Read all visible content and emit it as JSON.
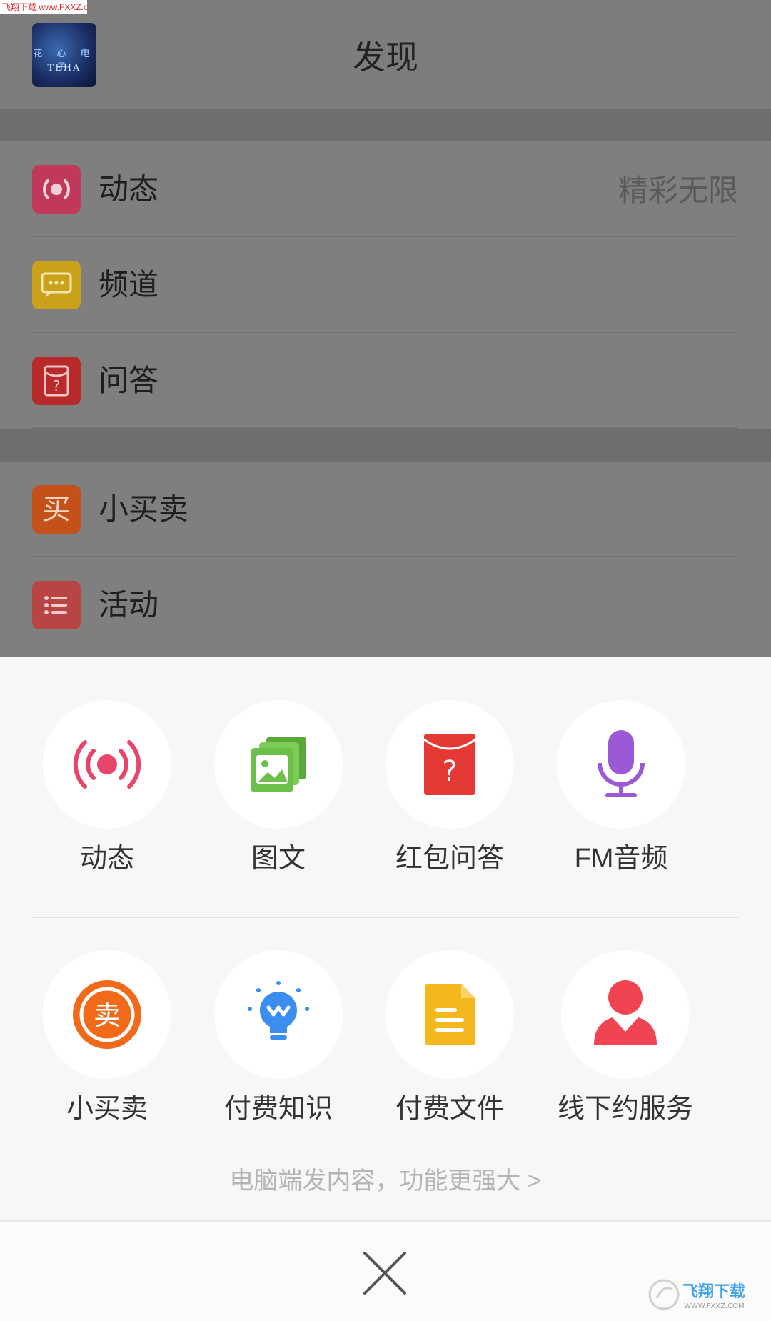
{
  "watermark_top": "飞翔下载 www.FXXZ.com",
  "header": {
    "title": "发现",
    "logo_text_cn": "花 心 电 子",
    "logo_text_en": "TEHA"
  },
  "list_group1": [
    {
      "label": "动态",
      "aside": "精彩无限",
      "icon": "broadcast-icon",
      "color": "#c0395b"
    },
    {
      "label": "频道",
      "aside": "",
      "icon": "chat-bubble-icon",
      "color": "#c9a21a"
    },
    {
      "label": "问答",
      "aside": "",
      "icon": "question-envelope-icon",
      "color": "#b82a2a"
    }
  ],
  "list_group2": [
    {
      "label": "小买卖",
      "icon": "buy-icon",
      "icon_char": "买",
      "color": "#c4511a"
    },
    {
      "label": "活动",
      "icon": "list-icon",
      "color": "#b84444"
    }
  ],
  "sheet": {
    "row1": [
      {
        "label": "动态",
        "icon": "broadcast-icon",
        "color": "#e8456a"
      },
      {
        "label": "图文",
        "icon": "image-gallery-icon",
        "color": "#6cc04a"
      },
      {
        "label": "红包问答",
        "icon": "red-envelope-question-icon",
        "color": "#e53935"
      },
      {
        "label": "FM音频",
        "icon": "microphone-icon",
        "color": "#9b59d6"
      }
    ],
    "row2": [
      {
        "label": "小买卖",
        "icon": "sell-icon",
        "icon_char": "卖",
        "color": "#f06a1a"
      },
      {
        "label": "付费知识",
        "icon": "lightbulb-icon",
        "color": "#3b8ef0"
      },
      {
        "label": "付费文件",
        "icon": "document-icon",
        "color": "#f5b81c"
      },
      {
        "label": "线下约服务",
        "icon": "person-icon",
        "color": "#f04452"
      }
    ],
    "pc_link": "电脑端发内容，功能更强大 >"
  },
  "watermark_bottom": {
    "main": "飞翔下载",
    "sub": "WWW.FXXZ.COM"
  }
}
